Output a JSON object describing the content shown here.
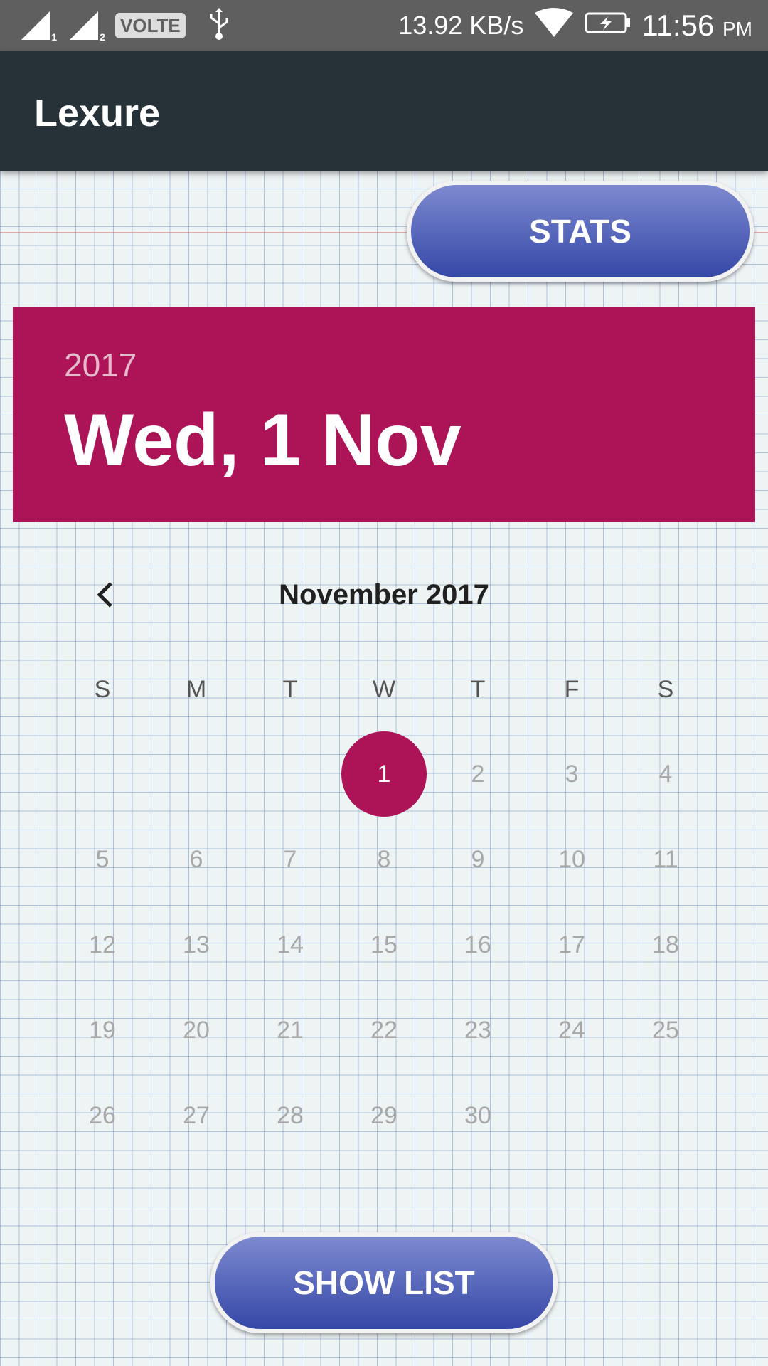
{
  "statusbar": {
    "sim1": "1",
    "sim2": "2",
    "volte": "VOLTE",
    "speed": "13.92 KB/s",
    "time": "11:56",
    "ampm": "PM"
  },
  "appbar": {
    "title": "Lexure"
  },
  "buttons": {
    "stats": "STATS",
    "show_list": "SHOW LIST"
  },
  "date_header": {
    "year": "2017",
    "date": "Wed, 1 Nov"
  },
  "calendar": {
    "month_title": "November 2017",
    "weekdays": [
      "S",
      "M",
      "T",
      "W",
      "T",
      "F",
      "S"
    ],
    "selected_day": "1",
    "days": [
      [
        "",
        "",
        "",
        "1",
        "2",
        "3",
        "4"
      ],
      [
        "5",
        "6",
        "7",
        "8",
        "9",
        "10",
        "11"
      ],
      [
        "12",
        "13",
        "14",
        "15",
        "16",
        "17",
        "18"
      ],
      [
        "19",
        "20",
        "21",
        "22",
        "23",
        "24",
        "25"
      ],
      [
        "26",
        "27",
        "28",
        "29",
        "30",
        "",
        ""
      ]
    ]
  },
  "colors": {
    "accent": "#ad1457",
    "appbar": "#263238",
    "button": "#3f51b5"
  }
}
